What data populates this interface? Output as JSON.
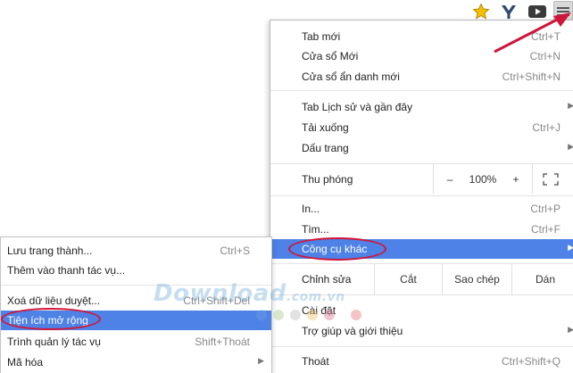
{
  "toolbar": {
    "icons": [
      "star-icon",
      "extension-y-icon",
      "youtube-icon",
      "hamburger-menu-icon"
    ]
  },
  "menu": {
    "new_tab": {
      "label": "Tab mới",
      "shortcut": "Ctrl+T"
    },
    "new_window": {
      "label": "Cửa sổ Mới",
      "shortcut": "Ctrl+N"
    },
    "incognito": {
      "label": "Cửa sổ ẩn danh mới",
      "shortcut": "Ctrl+Shift+N"
    },
    "history": {
      "label": "Tab Lịch sử và gần đây"
    },
    "downloads": {
      "label": "Tải xuống",
      "shortcut": "Ctrl+J"
    },
    "bookmarks": {
      "label": "Dấu trang"
    },
    "zoom": {
      "label": "Thu phóng",
      "minus": "–",
      "value": "100%",
      "plus": "+"
    },
    "print": {
      "label": "In...",
      "shortcut": "Ctrl+P"
    },
    "find": {
      "label": "Tìm...",
      "shortcut": "Ctrl+F"
    },
    "more_tools": {
      "label": "Công cụ khác"
    },
    "edit": {
      "label": "Chỉnh sửa",
      "cut": "Cắt",
      "copy": "Sao chép",
      "paste": "Dán"
    },
    "settings": {
      "label": "Cài đặt"
    },
    "help": {
      "label": "Trợ giúp và giới thiệu"
    },
    "exit": {
      "label": "Thoát",
      "shortcut": "Ctrl+Shift+Q"
    }
  },
  "submenu": {
    "save_page": {
      "label": "Lưu trang thành...",
      "shortcut": "Ctrl+S"
    },
    "add_taskbar": {
      "label": "Thêm vào thanh tác vụ..."
    },
    "clear_data": {
      "label": "Xoá dữ liệu duyệt...",
      "shortcut": "Ctrl+Shift+Del"
    },
    "extensions": {
      "label": "Tiện ích mở rộng"
    },
    "task_manager": {
      "label": "Trình quản lý tác vụ",
      "shortcut": "Shift+Thoát"
    },
    "encoding": {
      "label": "Mã hóa"
    }
  },
  "watermark": {
    "text": "Download",
    "suffix": ".com.vn"
  },
  "colors": {
    "highlight": "#4e82e6",
    "annotation_red": "#d0163a",
    "star": "#f2c200"
  }
}
